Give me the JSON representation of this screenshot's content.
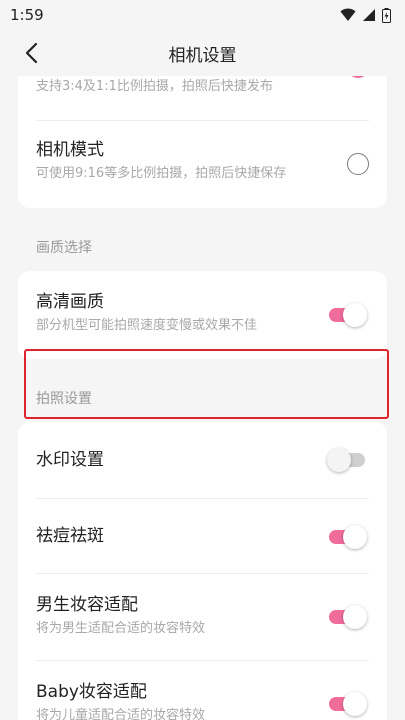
{
  "status_bar": {
    "time": "1:59"
  },
  "nav": {
    "title": "相机设置"
  },
  "camera_mode_card": {
    "items": [
      {
        "subtitle": "支持3:4及1:1比例拍摄，拍照后快捷发布",
        "checked": true
      },
      {
        "title": "相机模式",
        "subtitle": "可使用9:16等多比例拍摄，拍照后快捷保存",
        "checked": false
      }
    ]
  },
  "quality_section": {
    "header": "画质选择",
    "items": [
      {
        "title": "高清画质",
        "subtitle": "部分机型可能拍照速度变慢或效果不佳",
        "on": true
      }
    ]
  },
  "photo_section": {
    "header": "拍照设置",
    "items": [
      {
        "title": "水印设置",
        "on": false
      },
      {
        "title": "祛痘祛斑",
        "on": true
      },
      {
        "title": "男生妆容适配",
        "subtitle": "将为男生适配合适的妆容特效",
        "on": true
      },
      {
        "title": "Baby妆容适配",
        "subtitle": "将为儿童适配合适的妆容特效",
        "on": true
      }
    ]
  },
  "colors": {
    "accent": "#f06c9a",
    "highlight_border": "#e0242f"
  }
}
